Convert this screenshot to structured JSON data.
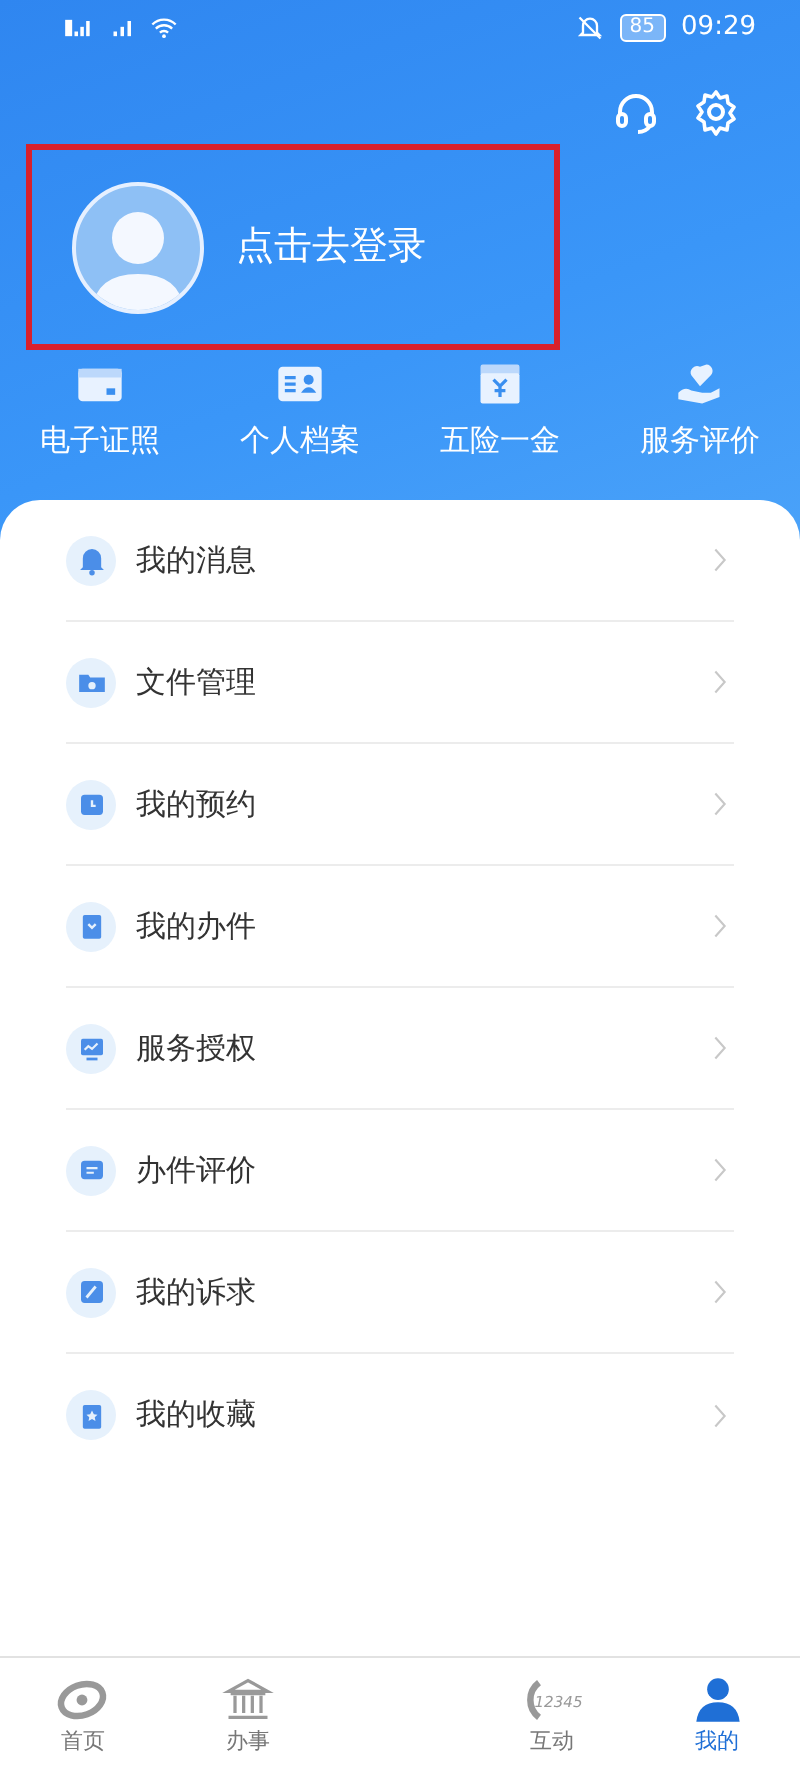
{
  "status_bar": {
    "battery": "85",
    "time": "09:29"
  },
  "profile": {
    "login_text": "点击去登录",
    "highlighted": true
  },
  "shortcuts": [
    {
      "label": "电子证照"
    },
    {
      "label": "个人档案"
    },
    {
      "label": "五险一金"
    },
    {
      "label": "服务评价"
    }
  ],
  "menu": [
    {
      "label": "我的消息"
    },
    {
      "label": "文件管理"
    },
    {
      "label": "我的预约"
    },
    {
      "label": "我的办件"
    },
    {
      "label": "服务授权"
    },
    {
      "label": "办件评价"
    },
    {
      "label": "我的诉求"
    },
    {
      "label": "我的收藏"
    }
  ],
  "bottom_nav": [
    {
      "label": "首页",
      "selected": false
    },
    {
      "label": "办事",
      "selected": false
    },
    {
      "label": "互动",
      "icon_text": "12345",
      "selected": false
    },
    {
      "label": "我的",
      "selected": true
    }
  ]
}
